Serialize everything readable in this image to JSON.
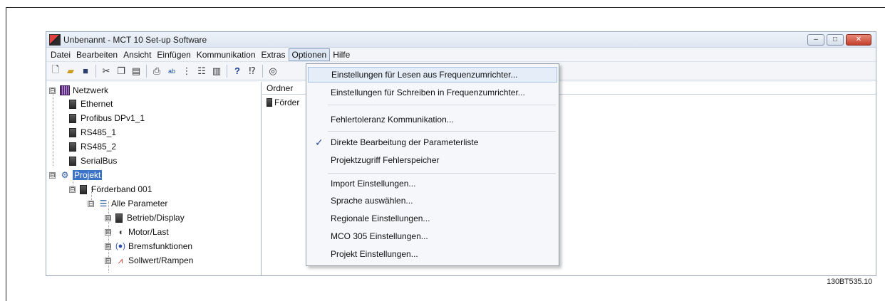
{
  "window": {
    "title": "Unbenannt - MCT 10 Set-up Software",
    "controls": [
      "–",
      "□",
      "✕"
    ]
  },
  "menubar": {
    "items": [
      "Datei",
      "Bearbeiten",
      "Ansicht",
      "Einfügen",
      "Kommunikation",
      "Extras",
      "Optionen",
      "Hilfe"
    ],
    "active": "Optionen"
  },
  "toolbar": {
    "icons": [
      "new-file-icon",
      "open-folder-icon",
      "save-icon",
      "cut-icon",
      "copy-icon",
      "paste-icon",
      "print-icon",
      "rename-icon",
      "tree-icon",
      "list-icon",
      "columns-icon",
      "help-icon",
      "context-help-icon",
      "connect-icon"
    ]
  },
  "tree": {
    "items": [
      {
        "label": "Netzwerk",
        "icon": "network-icon",
        "expander": "⊟"
      },
      {
        "label": "Ethernet",
        "icon": "device-icon"
      },
      {
        "label": "Profibus DPv1_1",
        "icon": "device-icon"
      },
      {
        "label": "RS485_1",
        "icon": "device-icon"
      },
      {
        "label": "RS485_2",
        "icon": "device-icon"
      },
      {
        "label": "SerialBus",
        "icon": "device-icon"
      },
      {
        "label": "Projekt",
        "icon": "project-icon",
        "expander": "⊟",
        "selected": true
      },
      {
        "label": "Förderband 001",
        "icon": "drive-icon",
        "expander": "⊟"
      },
      {
        "label": "Alle Parameter",
        "icon": "list-icon",
        "expander": "⊟"
      },
      {
        "label": "Betrieb/Display",
        "icon": "display-icon",
        "expander": "⊞"
      },
      {
        "label": "Motor/Last",
        "icon": "motor-icon",
        "expander": "⊞"
      },
      {
        "label": "Bremsfunktionen",
        "icon": "brake-icon",
        "expander": "⊞"
      },
      {
        "label": "Sollwert/Rampen",
        "icon": "ramp-icon",
        "expander": "⊞"
      }
    ]
  },
  "right_pane": {
    "column_header": "Ordner",
    "first_cell": "Förder"
  },
  "options_menu": {
    "items": [
      {
        "label": "Einstellungen für Lesen aus Frequenzumrichter...",
        "hover": true
      },
      {
        "label": "Einstellungen für Schreiben in Frequenzumrichter..."
      },
      {
        "label": "Fehlertoleranz Kommunikation..."
      },
      {
        "label": "Direkte Bearbeitung der Parameterliste",
        "checked": true,
        "check_mark": "✓"
      },
      {
        "label": "Projektzugriff Fehlerspeicher"
      },
      {
        "label": "Import Einstellungen..."
      },
      {
        "label": "Sprache auswählen..."
      },
      {
        "label": "Regionale Einstellungen..."
      },
      {
        "label": "MCO 305 Einstellungen..."
      },
      {
        "label": "Projekt Einstellungen..."
      }
    ]
  },
  "figure_code": "130BT535.10"
}
